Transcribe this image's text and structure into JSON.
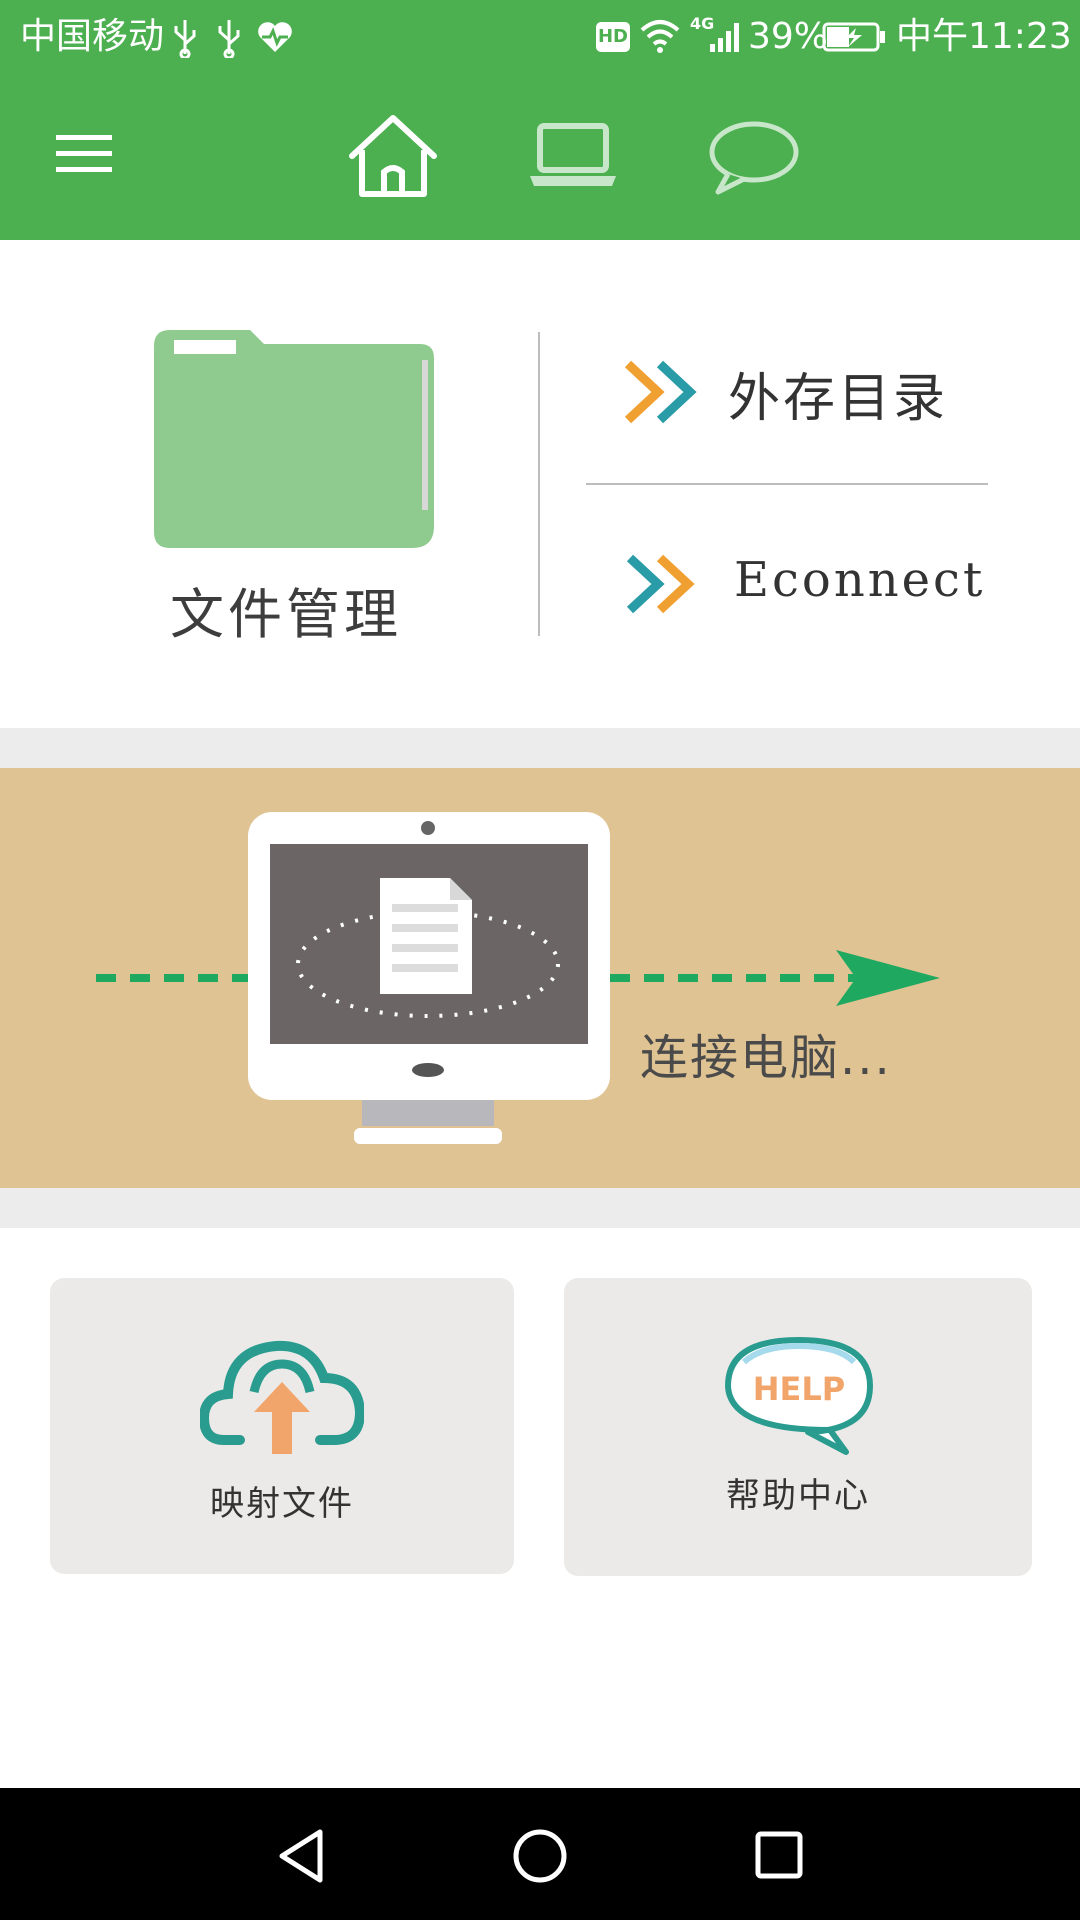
{
  "status_bar": {
    "carrier": "中国移动",
    "network": "4G",
    "battery": "39%",
    "time": "中午11:23",
    "hd_badge": "HD"
  },
  "top_bar": {
    "menu_icon": "hamburger-menu-icon",
    "tabs": [
      {
        "icon": "home-icon",
        "active": true
      },
      {
        "icon": "laptop-icon",
        "active": false
      },
      {
        "icon": "chat-bubble-icon",
        "active": false
      }
    ]
  },
  "file_panel": {
    "folder_label": "文件管理",
    "links": [
      {
        "label": "外存目录"
      },
      {
        "label": "Econnect"
      }
    ]
  },
  "banner": {
    "text": "连接电脑..."
  },
  "cards": [
    {
      "label": "映射文件",
      "icon": "cloud-upload-icon"
    },
    {
      "label": "帮助中心",
      "icon": "help-bubble-icon",
      "icon_text": "HELP"
    }
  ],
  "colors": {
    "primary_green": "#4caf50",
    "folder_green": "#8fca8f",
    "banner_bg": "#dfc393",
    "arrow_orange": "#f0a030",
    "arrow_teal": "#2a9ca8",
    "help_orange": "#f2a56a"
  }
}
